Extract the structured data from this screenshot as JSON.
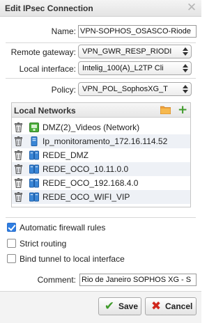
{
  "dialog": {
    "title": "Edit IPsec Connection",
    "close_symbol": "✕"
  },
  "form": {
    "name": {
      "label": "Name:",
      "value": "VPN-SOPHOS_OSASCO-Riode"
    },
    "remote_gateway": {
      "label": "Remote gateway:",
      "value": "VPN_GWR_RESP_RIODI"
    },
    "local_interface": {
      "label": "Local interface:",
      "value": "Intelig_100(A)_L2TP Cli"
    },
    "policy": {
      "label": "Policy:",
      "value": "VPN_POL_SophosXG_T"
    },
    "comment": {
      "label": "Comment:",
      "value": "Rio de Janeiro SOPHOS XG - S"
    }
  },
  "local_networks": {
    "title": "Local Networks",
    "add_symbol": "+",
    "items": [
      {
        "label": "DMZ(2)_Videos (Network)",
        "icon": "network-icon"
      },
      {
        "label": "Ip_monitoramento_172.16.114.52",
        "icon": "host-icon"
      },
      {
        "label": "REDE_DMZ",
        "icon": "network-group-icon"
      },
      {
        "label": "REDE_OCO_10.11.0.0",
        "icon": "network-group-icon"
      },
      {
        "label": "REDE_OCO_192.168.4.0",
        "icon": "network-group-icon"
      },
      {
        "label": "REDE_OCO_WIFI_VIP",
        "icon": "network-group-icon"
      }
    ]
  },
  "options": {
    "auto_firewall": {
      "label": "Automatic firewall rules",
      "checked": true
    },
    "strict_routing": {
      "label": "Strict routing",
      "checked": false
    },
    "bind_tunnel": {
      "label": "Bind tunnel to local interface",
      "checked": false
    }
  },
  "buttons": {
    "save": {
      "label": "Save",
      "symbol": "✔"
    },
    "cancel": {
      "label": "Cancel",
      "symbol": "✖"
    }
  },
  "colors": {
    "accent_green": "#3f9a2a",
    "cancel_red": "#d0271d",
    "checkbox_blue": "#2f7de1",
    "folder_orange": "#f0a23a"
  }
}
